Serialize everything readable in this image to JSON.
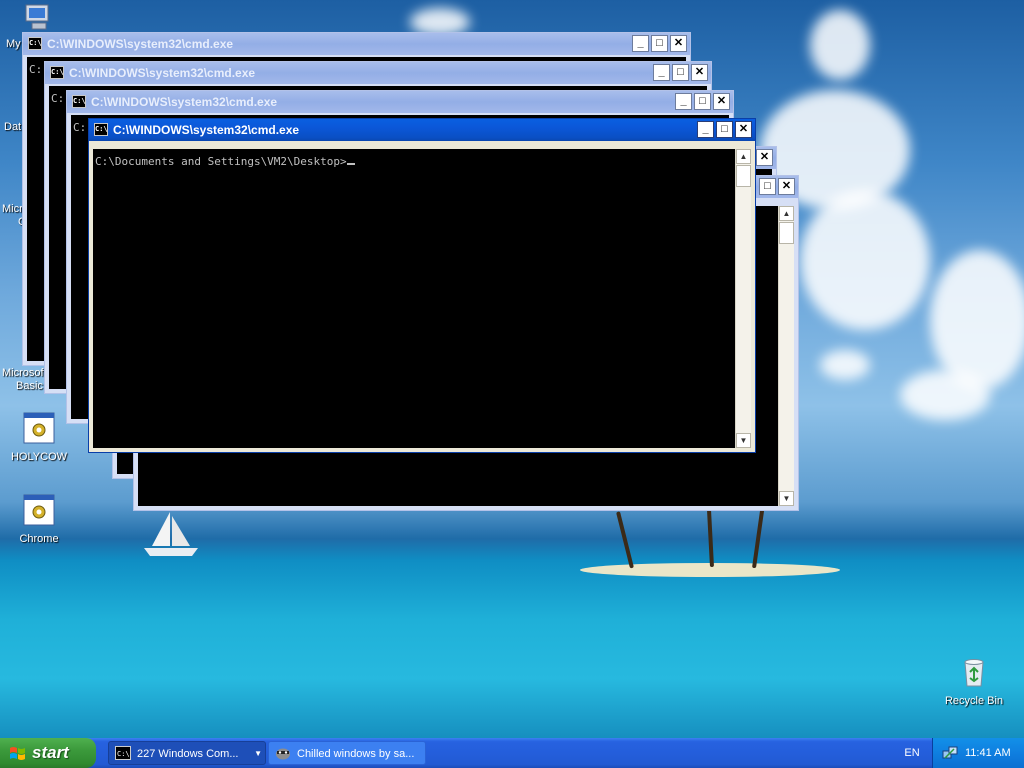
{
  "desktop": {
    "icons": [
      {
        "id": "holycow",
        "label": "HOLYCOW"
      },
      {
        "id": "chrome",
        "label": "Chrome"
      },
      {
        "id": "recycle",
        "label": "Recycle Bin"
      }
    ],
    "partial_labels": {
      "my": "My",
      "dat": "Dat",
      "micro1": "Micro",
      "micro1b": "C",
      "micro2": "Microsoft",
      "micro2b": "Basic"
    }
  },
  "cmd": {
    "window_title": "C:\\WINDOWS\\system32\\cmd.exe",
    "icon_text": "C:\\",
    "prompt": "C:\\Documents and Settings\\VM2\\Desktop>",
    "partial_prompt": "C:"
  },
  "taskbar": {
    "start_label": "start",
    "tasks": [
      {
        "label": "227 Windows Com...",
        "icon": "cmd-icon"
      },
      {
        "label": "Chilled windows by sa...",
        "icon": "raccoon-icon"
      }
    ],
    "language": "EN",
    "clock": "11:41 AM"
  },
  "colors": {
    "titlebar_active": "#0a57d8",
    "titlebar_inactive": "#93aee6",
    "taskbar": "#245edb",
    "start_button": "#3c9a3c",
    "console_bg": "#000000"
  }
}
